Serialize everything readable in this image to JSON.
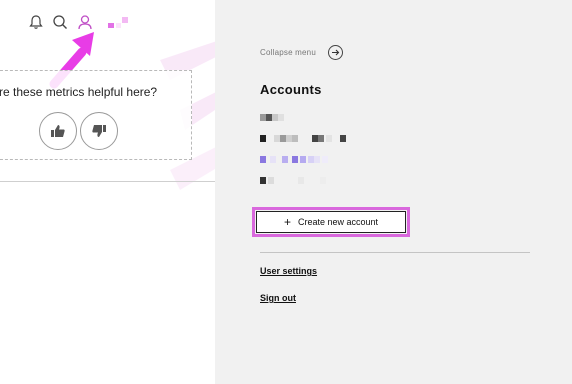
{
  "toolbar": {
    "icons": [
      "bell-icon",
      "search-icon",
      "user-icon"
    ]
  },
  "feedback": {
    "question": "Are these metrics helpful here?",
    "up_icon": "thumbs-up-icon",
    "down_icon": "thumbs-down-icon"
  },
  "colors": {
    "accent": "#d968dd",
    "panel_bg": "#f1f1f1"
  },
  "menu": {
    "collapse_label": "Collapse menu",
    "accounts_heading": "Accounts",
    "create_account_label": "Create new account",
    "user_settings_label": "User settings",
    "sign_out_label": "Sign out"
  }
}
